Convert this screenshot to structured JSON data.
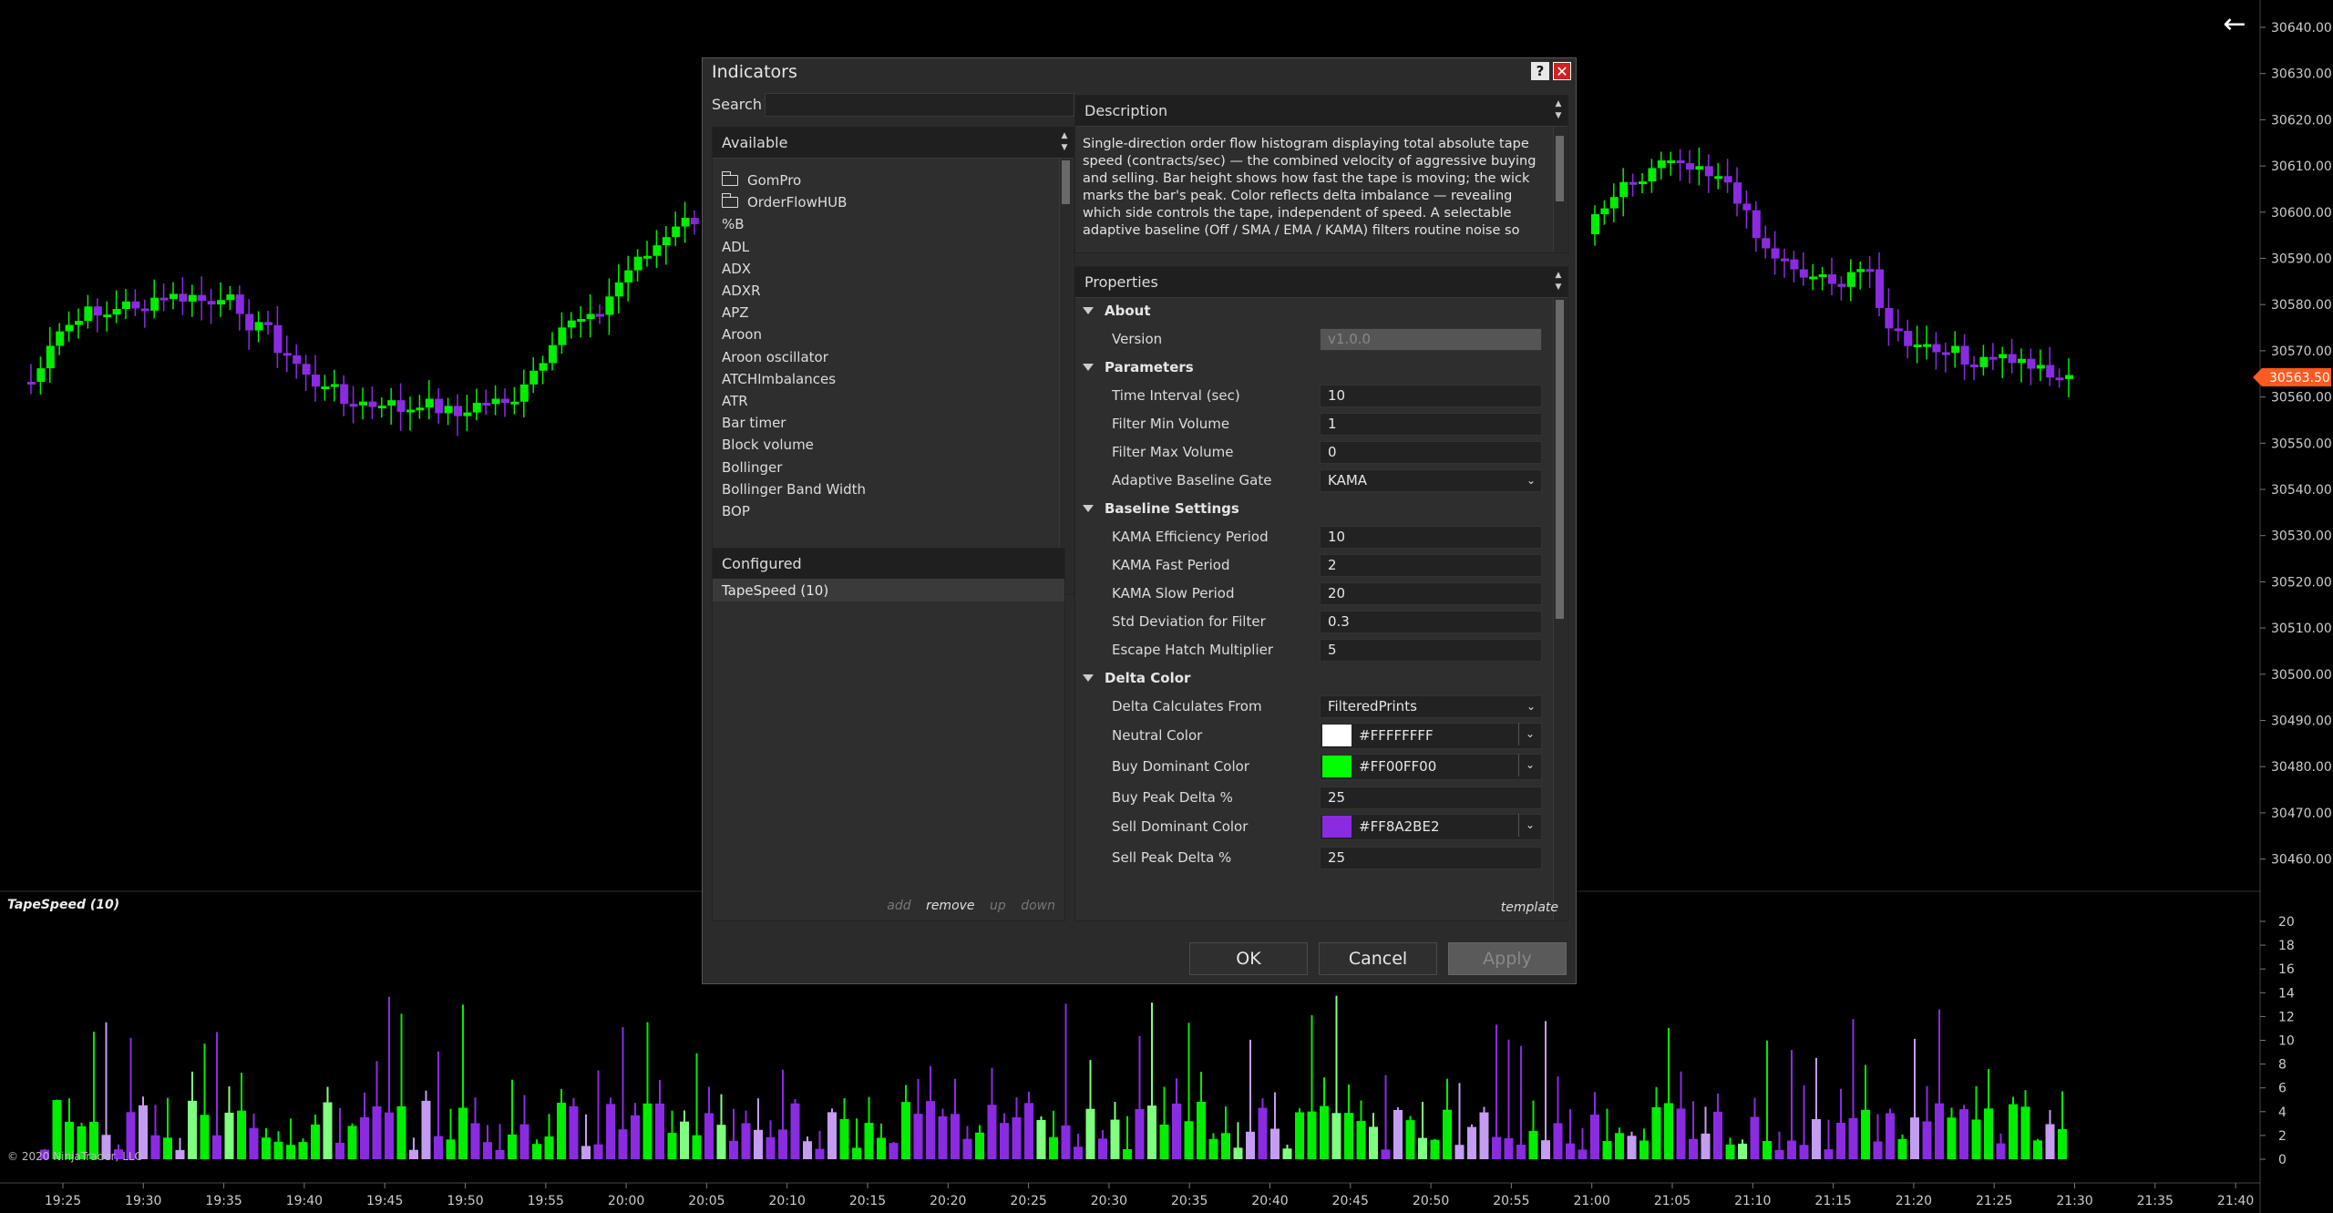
{
  "chart": {
    "price_labels": [
      "30640.00",
      "30630.00",
      "30620.00",
      "30610.00",
      "30600.00",
      "30590.00",
      "30580.00",
      "30570.00",
      "30560.00",
      "30550.00",
      "30540.00",
      "30530.00",
      "30520.00",
      "30510.00",
      "30500.00",
      "30490.00",
      "30480.00",
      "30470.00",
      "30460.00"
    ],
    "current_price": "30563.50",
    "current_price_color": "#ff5a1f",
    "indicator_labels": [
      "20",
      "18",
      "16",
      "14",
      "12",
      "10",
      "8",
      "6",
      "4",
      "2",
      "0"
    ],
    "time_labels": [
      "19:25",
      "19:30",
      "19:35",
      "19:40",
      "19:45",
      "19:50",
      "19:55",
      "20:00",
      "20:05",
      "20:10",
      "20:15",
      "20:20",
      "20:25",
      "20:30",
      "20:35",
      "20:40",
      "20:45",
      "20:50",
      "20:55",
      "21:00",
      "21:05",
      "21:10",
      "21:15",
      "21:20",
      "21:25",
      "21:30",
      "21:35",
      "21:40"
    ],
    "panel_label": "TapeSpeed (10)",
    "copyright": "© 2020 NinjaTrader, LLC",
    "up_color": "#00ee00",
    "down_color": "#8a2be2"
  },
  "dialog": {
    "title": "Indicators",
    "help_label": "?",
    "close_label": "✕",
    "search_label": "Search",
    "search_value": "",
    "available_header": "Available",
    "available_items": [
      {
        "label": "GomPro",
        "icon": "folder-icon"
      },
      {
        "label": "OrderFlowHUB",
        "icon": "folder-icon"
      },
      {
        "label": "%B"
      },
      {
        "label": "ADL"
      },
      {
        "label": "ADX"
      },
      {
        "label": "ADXR"
      },
      {
        "label": "APZ"
      },
      {
        "label": "Aroon"
      },
      {
        "label": "Aroon oscillator"
      },
      {
        "label": "ATCHImbalances"
      },
      {
        "label": "ATR"
      },
      {
        "label": "Bar timer"
      },
      {
        "label": "Block volume"
      },
      {
        "label": "Bollinger"
      },
      {
        "label": "Bollinger Band Width"
      },
      {
        "label": "BOP"
      }
    ],
    "configured_header": "Configured",
    "configured_items": [
      "TapeSpeed (10)"
    ],
    "actions": {
      "add": "add",
      "remove": "remove",
      "up": "up",
      "down": "down"
    },
    "description_header": "Description",
    "description_text": "Single-direction order flow histogram displaying total absolute tape speed (contracts/sec) — the combined velocity of aggressive buying and selling. Bar height shows how fast the tape is moving; the wick marks the bar's peak. Color reflects delta imbalance — revealing which side controls the tape, independent of speed. A selectable adaptive baseline (Off / SMA / EMA / KAMA) filters routine noise so",
    "properties_header": "Properties",
    "properties": [
      {
        "type": "category",
        "label": "About"
      },
      {
        "type": "prop",
        "label": "Version",
        "value": "v1.0.0",
        "disabled": true
      },
      {
        "type": "category",
        "label": "Parameters"
      },
      {
        "type": "prop",
        "label": "Time Interval (sec)",
        "value": "10"
      },
      {
        "type": "prop",
        "label": "Filter Min Volume",
        "value": "1"
      },
      {
        "type": "prop",
        "label": "Filter Max Volume",
        "value": "0"
      },
      {
        "type": "select",
        "label": "Adaptive Baseline Gate",
        "value": "KAMA"
      },
      {
        "type": "category",
        "label": "Baseline Settings"
      },
      {
        "type": "prop",
        "label": "KAMA Efficiency Period",
        "value": "10"
      },
      {
        "type": "prop",
        "label": "KAMA Fast Period",
        "value": "2"
      },
      {
        "type": "prop",
        "label": "KAMA Slow Period",
        "value": "20"
      },
      {
        "type": "prop",
        "label": "Std Deviation for Filter",
        "value": "0.3"
      },
      {
        "type": "prop",
        "label": "Escape Hatch Multiplier",
        "value": "5"
      },
      {
        "type": "category",
        "label": "Delta Color"
      },
      {
        "type": "select",
        "label": "Delta Calculates From",
        "value": "FilteredPrints"
      },
      {
        "type": "color",
        "label": "Neutral Color",
        "value": "#FFFFFFFF",
        "swatch": "#ffffff"
      },
      {
        "type": "color",
        "label": "Buy Dominant Color",
        "value": "#FF00FF00",
        "swatch": "#00ff00"
      },
      {
        "type": "prop",
        "label": "Buy Peak Delta %",
        "value": "25"
      },
      {
        "type": "color",
        "label": "Sell Dominant Color",
        "value": "#FF8A2BE2",
        "swatch": "#8a2be2"
      },
      {
        "type": "prop",
        "label": "Sell Peak Delta %",
        "value": "25"
      }
    ],
    "template_link": "template",
    "buttons": {
      "ok": "OK",
      "cancel": "Cancel",
      "apply": "Apply"
    }
  }
}
